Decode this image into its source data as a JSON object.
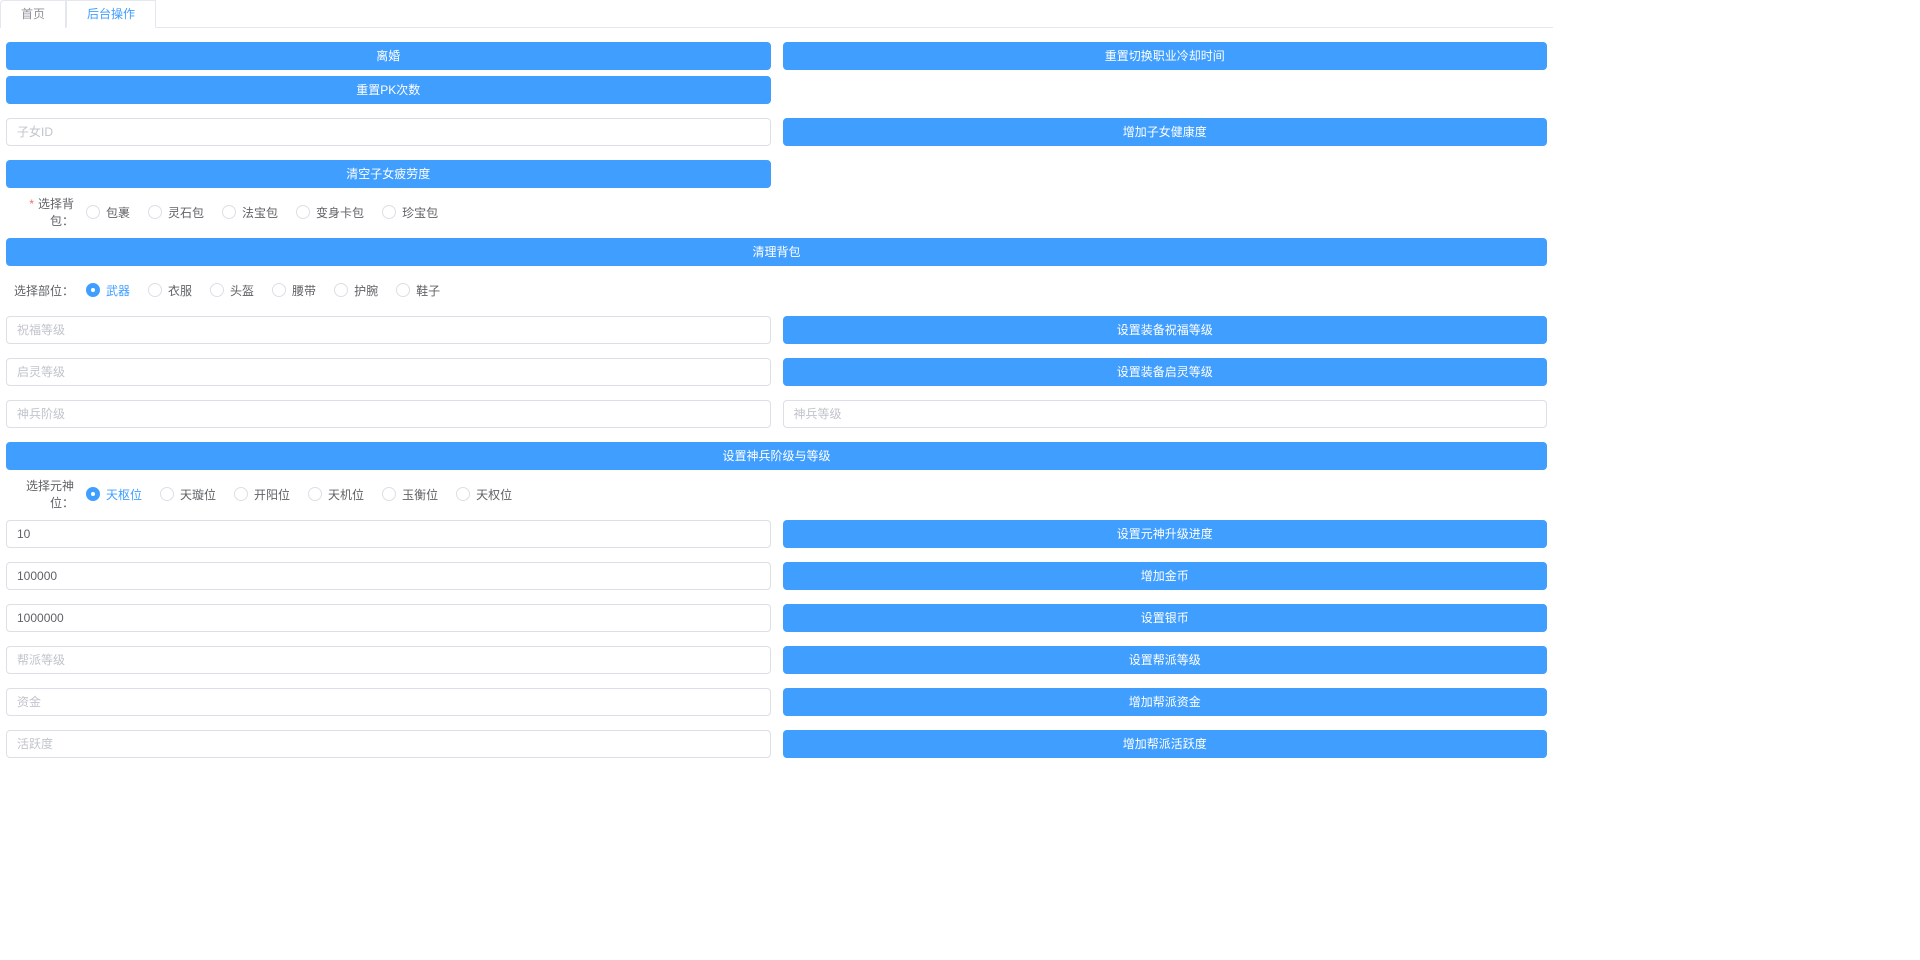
{
  "tabs": {
    "home": "首页",
    "admin": "后台操作"
  },
  "buttons": {
    "divorce": "离婚",
    "resetJobCooldown": "重置切换职业冷却时间",
    "resetPkCount": "重置PK次数",
    "addChildHealth": "增加子女健康度",
    "clearChildFatigue": "清空子女疲劳度",
    "cleanBag": "清理背包",
    "setEquipBlessLevel": "设置装备祝福等级",
    "setEquipQilingLevel": "设置装备启灵等级",
    "setShenbingStageLevel": "设置神兵阶级与等级",
    "setYuanshenProgress": "设置元神升级进度",
    "addGold": "增加金币",
    "setSilver": "设置银币",
    "setGuildLevel": "设置帮派等级",
    "addGuildFunds": "增加帮派资金",
    "addGuildActivity": "增加帮派活跃度"
  },
  "placeholders": {
    "childId": "子女ID",
    "blessLevel": "祝福等级",
    "qilingLevel": "启灵等级",
    "shenbingStage": "神兵阶级",
    "shenbingLevel": "神兵等级",
    "guildLevel": "帮派等级",
    "funds": "资金",
    "activity": "活跃度"
  },
  "values": {
    "yuanshenProgress": "10",
    "goldAmount": "100000",
    "silverAmount": "1000000"
  },
  "labels": {
    "selectBag": "选择背包：",
    "selectPart": "选择部位：",
    "selectYuanshen": "选择元神位："
  },
  "radios": {
    "bag": [
      "包裹",
      "灵石包",
      "法宝包",
      "变身卡包",
      "珍宝包"
    ],
    "part": [
      "武器",
      "衣服",
      "头盔",
      "腰带",
      "护腕",
      "鞋子"
    ],
    "yuanshen": [
      "天枢位",
      "天璇位",
      "开阳位",
      "天机位",
      "玉衡位",
      "天权位"
    ]
  }
}
